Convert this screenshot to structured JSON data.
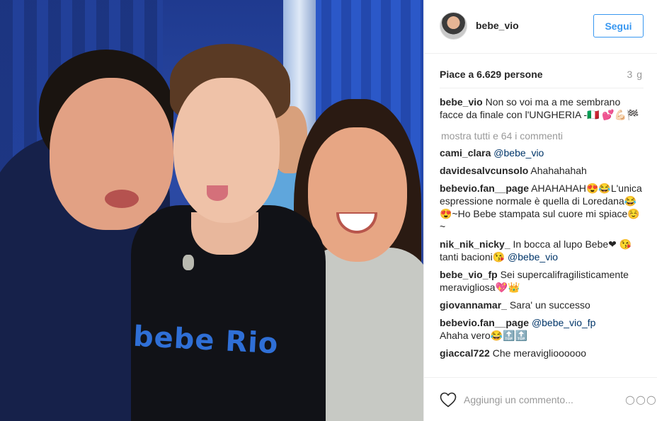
{
  "post": {
    "username": "bebe_vio",
    "follow_label": "Segui",
    "likes_text": "Piace a 6.629 persone",
    "time_ago": "3 g",
    "shirt_text": "bebe Rio",
    "caption": {
      "user": "bebe_vio",
      "text": "Non so voi ma a me sembrano facce da finale con l'UNGHERIA         -🇮🇹 💕💪🏻🏁"
    },
    "show_all_label": "mostra tutti e 64 i commenti",
    "comments": [
      {
        "user": "cami_clara",
        "text": "",
        "mention": "@bebe_vio",
        "tail": ""
      },
      {
        "user": "davidesalvcunsolo",
        "text": "Ahahahahah",
        "mention": "",
        "tail": ""
      },
      {
        "user": "bebevio.fan__page",
        "text": "AHAHAHAH😍😂L'unica espressione normale è quella di Loredana😂😍~Ho Bebe stampata sul cuore mi spiace☺️~",
        "mention": "",
        "tail": ""
      },
      {
        "user": "nik_nik_nicky_",
        "text": "In bocca al lupo Bebe❤ 😘 tanti bacioni😘",
        "mention": "@bebe_vio",
        "tail": ""
      },
      {
        "user": "bebe_vio_fp",
        "text": "Sei supercalifragilisticamente meravigliosa💖👑",
        "mention": "",
        "tail": ""
      },
      {
        "user": "giovannamar_",
        "text": "Sara' un successo",
        "mention": "",
        "tail": ""
      },
      {
        "user": "bebevio.fan__page",
        "text": "",
        "mention": "@bebe_vio_fp",
        "tail": "Ahaha vero😂🔝🔝"
      },
      {
        "user": "giaccal722",
        "text": "Che meraviglioooooo",
        "mention": "",
        "tail": ""
      }
    ],
    "add_comment_placeholder": "Aggiungi un commento...",
    "more_options": "○○○"
  },
  "icons": {
    "heart": "heart-icon",
    "more": "more-options-icon",
    "avatar": "profile-avatar"
  },
  "colors": {
    "accent": "#3897f0",
    "muted": "#999999",
    "text": "#262626",
    "border": "#efefef"
  }
}
